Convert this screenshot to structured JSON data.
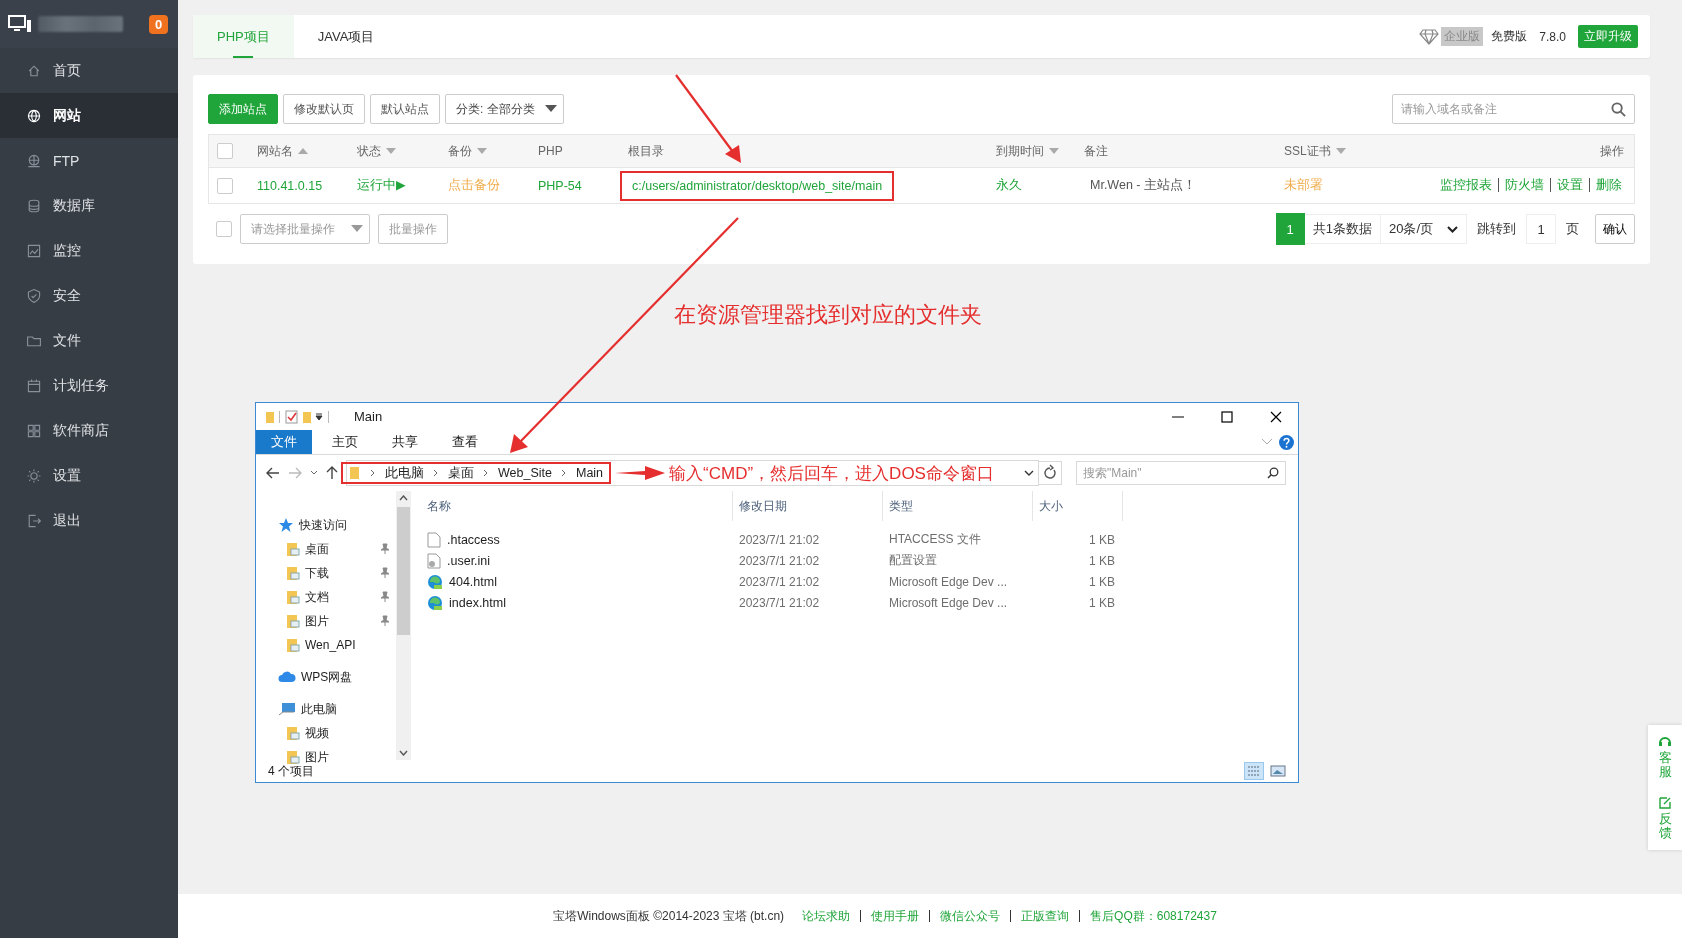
{
  "sidebar": {
    "badge": "0",
    "items": [
      {
        "label": "首页",
        "selected": false
      },
      {
        "label": "网站",
        "selected": true
      },
      {
        "label": "FTP",
        "selected": false
      },
      {
        "label": "数据库",
        "selected": false
      },
      {
        "label": "监控",
        "selected": false
      },
      {
        "label": "安全",
        "selected": false
      },
      {
        "label": "文件",
        "selected": false
      },
      {
        "label": "计划任务",
        "selected": false
      },
      {
        "label": "软件商店",
        "selected": false
      },
      {
        "label": "设置",
        "selected": false
      },
      {
        "label": "退出",
        "selected": false
      }
    ]
  },
  "top_bar": {
    "tabs": [
      {
        "label": "PHP项目",
        "selected": true
      },
      {
        "label": "JAVA项目",
        "selected": false
      }
    ],
    "enterprise_label": "企业版",
    "edition": "免费版",
    "version": "7.8.0",
    "upgrade_button": "立即升级"
  },
  "toolbar": {
    "buttons": [
      {
        "label": "添加站点",
        "kind": "primary"
      },
      {
        "label": "修改默认页",
        "kind": "default"
      },
      {
        "label": "默认站点",
        "kind": "default"
      }
    ],
    "category_select": "分类: 全部分类",
    "search": {
      "placeholder": "请输入域名或备注"
    }
  },
  "table": {
    "columns": [
      {
        "label": "网站名",
        "sortable": true,
        "ascending": true
      },
      {
        "label": "状态",
        "sortable": true,
        "ascending": false
      },
      {
        "label": "备份",
        "sortable": true,
        "ascending": false
      },
      {
        "label": "PHP",
        "sortable": false
      },
      {
        "label": "根目录",
        "sortable": false
      },
      {
        "label": "到期时间",
        "sortable": true,
        "ascending": false
      },
      {
        "label": "备注",
        "sortable": false
      },
      {
        "label": "SSL证书",
        "sortable": true,
        "ascending": false
      },
      {
        "label": "操作",
        "sortable": false
      }
    ],
    "all_checked": false,
    "rows": [
      {
        "checked": false,
        "name": "110.41.0.15",
        "status": "运行中▶",
        "backup": "点击备份",
        "php": "PHP-54",
        "root": "c:/users/administrator/desktop/web_site/main",
        "root_highlighted": true,
        "expiry": "永久",
        "note": "Mr.Wen - 主站点！",
        "ssl": "未部署",
        "actions": [
          "监控报表",
          "防火墙",
          "设置",
          "删除"
        ]
      }
    ]
  },
  "batch": {
    "checked": false,
    "select_placeholder": "请选择批量操作",
    "button": "批量操作"
  },
  "pagination": {
    "pages": [
      {
        "label": "1",
        "selected": true
      }
    ],
    "total": "共1条数据",
    "per_page": "20条/页",
    "goto_label": "跳转到",
    "page_input": "1",
    "page_unit": "页",
    "confirm": "确认"
  },
  "annotations": [
    "在资源管理器找到对应的文件夹",
    "输入“CMD”，然后回车，进入DOS命令窗口"
  ],
  "explorer": {
    "title": "Main",
    "ribbon_tabs": [
      {
        "label": "文件",
        "selected": true
      },
      {
        "label": "主页",
        "selected": false
      },
      {
        "label": "共享",
        "selected": false
      },
      {
        "label": "查看",
        "selected": false
      }
    ],
    "breadcrumb": [
      "此电脑",
      "桌面",
      "Web_Site",
      "Main"
    ],
    "search": {
      "placeholder": "搜索\"Main\""
    },
    "nav": [
      {
        "label": "快速访问",
        "kind": "star",
        "children": [
          {
            "label": "桌面",
            "kind": "folder",
            "pinned": true
          },
          {
            "label": "下载",
            "kind": "folder",
            "pinned": true
          },
          {
            "label": "文档",
            "kind": "folder",
            "pinned": true
          },
          {
            "label": "图片",
            "kind": "folder",
            "pinned": true
          },
          {
            "label": "Wen_API",
            "kind": "folder",
            "pinned": false
          }
        ]
      },
      {
        "label": "WPS网盘",
        "kind": "cloud"
      },
      {
        "label": "此电脑",
        "kind": "computer",
        "children": [
          {
            "label": "视频",
            "kind": "folder",
            "pinned": false
          },
          {
            "label": "图片",
            "kind": "folder",
            "pinned": false
          }
        ]
      }
    ],
    "columns": [
      "名称",
      "修改日期",
      "类型",
      "大小"
    ],
    "files": [
      {
        "name": ".htaccess",
        "kind": "file",
        "date": "2023/7/1 21:02",
        "type": "HTACCESS 文件",
        "size": "1 KB"
      },
      {
        "name": ".user.ini",
        "kind": "config",
        "date": "2023/7/1 21:02",
        "type": "配置设置",
        "size": "1 KB"
      },
      {
        "name": "404.html",
        "kind": "edge",
        "date": "2023/7/1 21:02",
        "type": "Microsoft Edge Dev ...",
        "size": "1 KB"
      },
      {
        "name": "index.html",
        "kind": "edge",
        "date": "2023/7/1 21:02",
        "type": "Microsoft Edge Dev ...",
        "size": "1 KB"
      }
    ],
    "status": "4 个项目"
  },
  "footer": {
    "text": "宝塔Windows面板 ©2014-2023 宝塔 (bt.cn)",
    "links": [
      "论坛求助",
      "使用手册",
      "微信公众号",
      "正版查询",
      "售后QQ群：608172437"
    ]
  },
  "side_float": [
    "客服",
    "反馈"
  ]
}
